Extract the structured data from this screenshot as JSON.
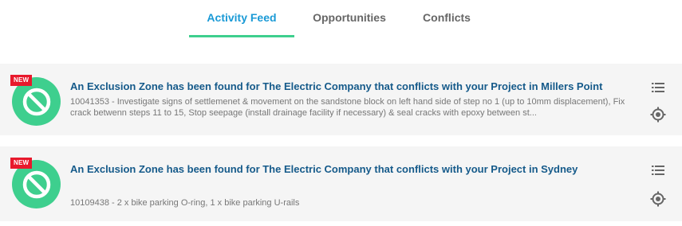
{
  "tabs": [
    {
      "label": "Activity Feed",
      "active": true
    },
    {
      "label": "Opportunities",
      "active": false
    },
    {
      "label": "Conflicts",
      "active": false
    }
  ],
  "feed": [
    {
      "badge": "NEW",
      "icon": "prohibited-icon",
      "title": "An Exclusion Zone has been found for The Electric Company that conflicts with your Project in Millers Point",
      "description": "10041353 - Investigate signs of settlemenet & movement on the sandstone block on left hand side of step no 1 (up to 10mm displacement), Fix crack betwenn steps 11 to 15, Stop seepage (install drainage facility if necessary) & seal cracks with epoxy between st...",
      "actions": [
        "list-icon",
        "locate-icon"
      ]
    },
    {
      "badge": "NEW",
      "icon": "prohibited-icon",
      "title": "An Exclusion Zone has been found for The Electric Company that conflicts with your Project in Sydney",
      "description": "10109438 - 2 x bike parking O-ring, 1 x bike parking U-rails",
      "actions": [
        "list-icon",
        "locate-icon"
      ]
    }
  ],
  "colors": {
    "accent": "#3ecf8e",
    "tab_active": "#1a9ad6",
    "title": "#155a8a",
    "badge": "#e8192c"
  }
}
